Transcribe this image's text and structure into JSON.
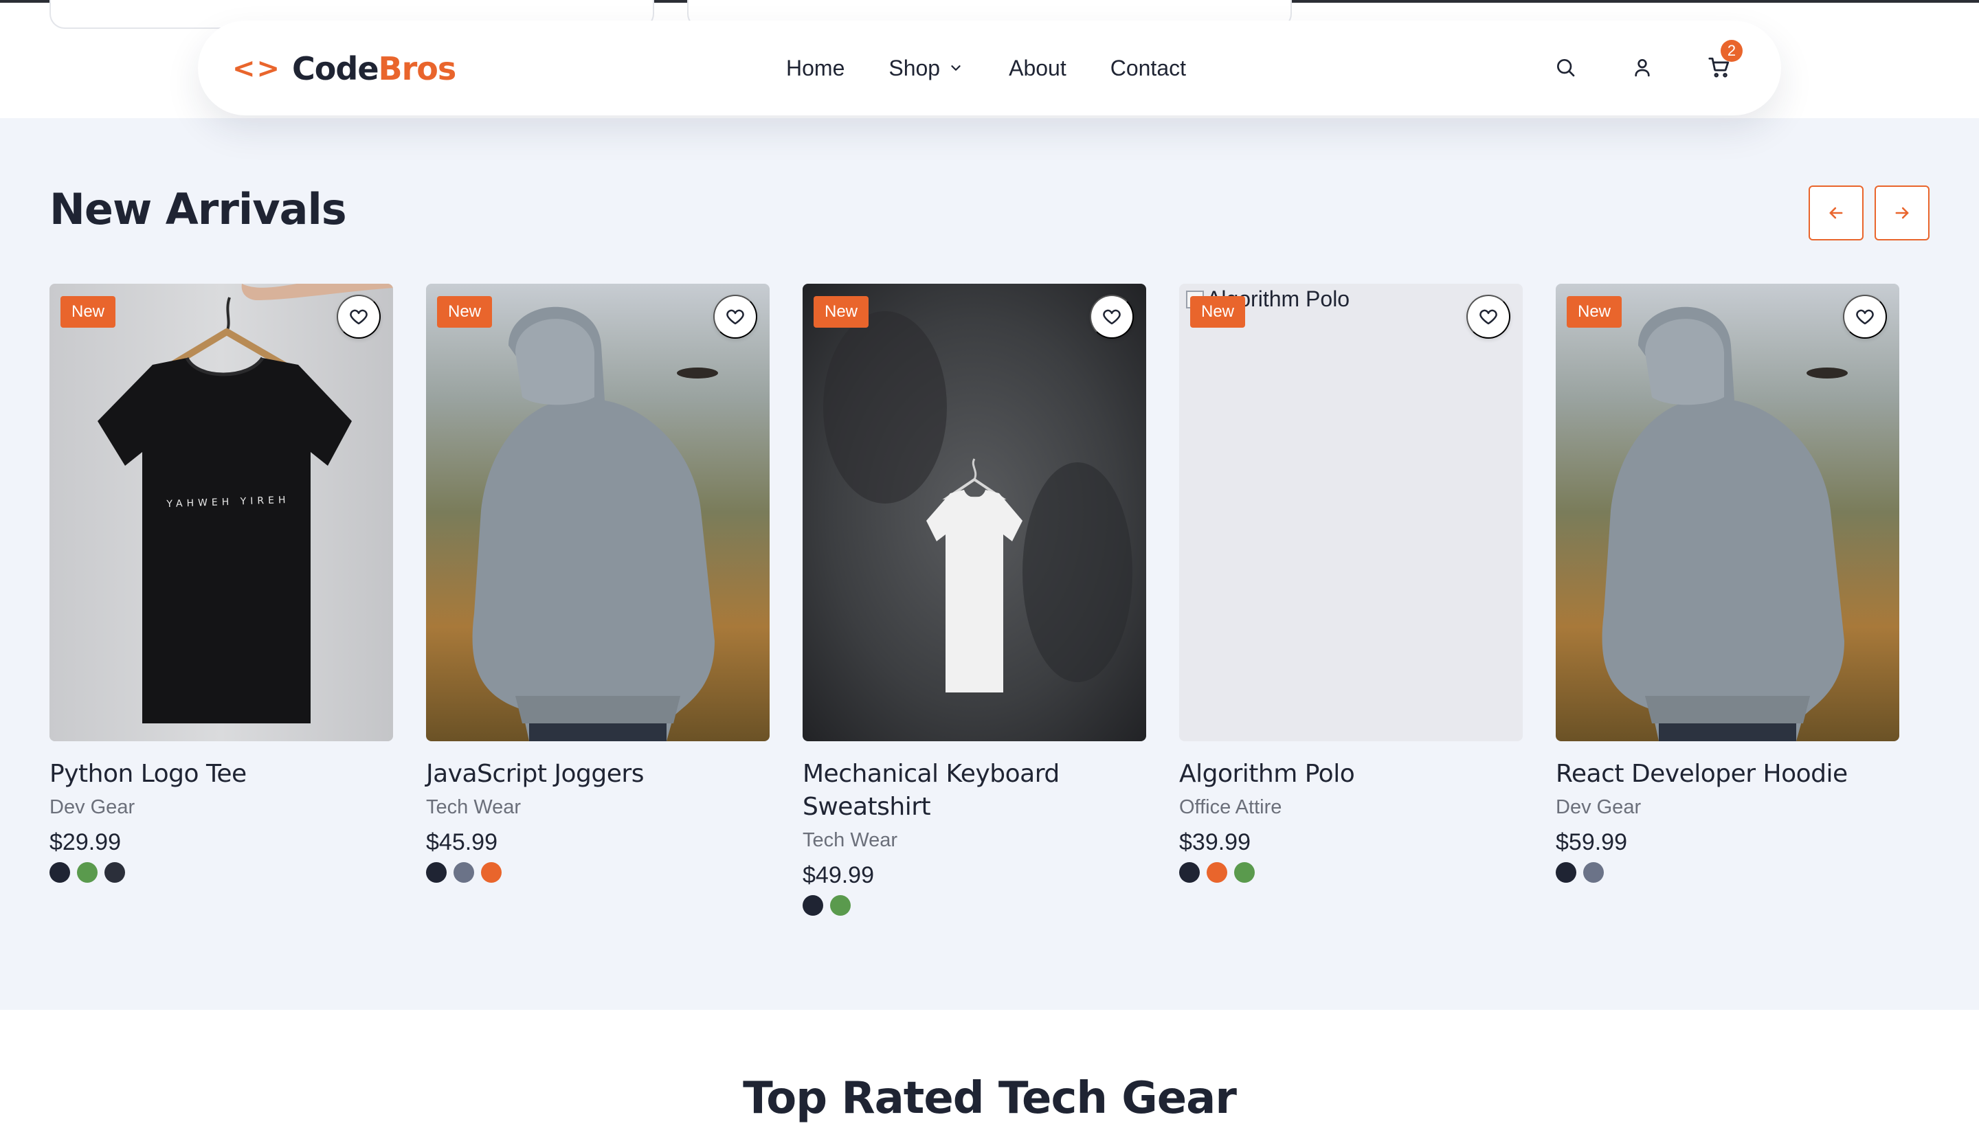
{
  "brand": {
    "mark": "<>",
    "name_primary": "Code",
    "name_accent": "Bros",
    "accent_color": "#e9652c"
  },
  "nav": {
    "links": [
      {
        "label": "Home"
      },
      {
        "label": "Shop",
        "has_dropdown": true
      },
      {
        "label": "About"
      },
      {
        "label": "Contact"
      }
    ],
    "icons": [
      "search-icon",
      "user-icon",
      "cart-icon"
    ],
    "cart_count": "2"
  },
  "new_arrivals": {
    "title": "New Arrivals",
    "prev_icon": "arrow-left-icon",
    "next_icon": "arrow-right-icon",
    "products": [
      {
        "name": "Python Logo Tee",
        "category": "Dev Gear",
        "price": "$29.99",
        "badge": "New",
        "image": "black-tshirt-on-hanger",
        "image_text": "YAHWEH YIREH",
        "colors": [
          "#1f2433",
          "#5a9a4d",
          "#2b2f3a"
        ]
      },
      {
        "name": "JavaScript Joggers",
        "category": "Tech Wear",
        "price": "$45.99",
        "badge": "New",
        "image": "grey-hoodie-back",
        "colors": [
          "#1f2433",
          "#6b7388",
          "#e9652c"
        ]
      },
      {
        "name": "Mechanical Keyboard Sweatshirt",
        "category": "Tech Wear",
        "price": "$49.99",
        "badge": "New",
        "image": "white-tshirt-on-dark-wall",
        "colors": [
          "#1f2433",
          "#5a9a4d"
        ]
      },
      {
        "name": "Algorithm Polo",
        "category": "Office Attire",
        "price": "$39.99",
        "badge": "New",
        "image": "broken",
        "alt": "Algorithm Polo",
        "colors": [
          "#1f2433",
          "#e9652c",
          "#5a9a4d"
        ]
      },
      {
        "name": "React Developer Hoodie",
        "category": "Dev Gear",
        "price": "$59.99",
        "badge": "New",
        "image": "grey-hoodie-back",
        "colors": [
          "#1f2433",
          "#6b7388"
        ]
      }
    ]
  },
  "top_rated": {
    "title": "Top Rated Tech Gear"
  }
}
